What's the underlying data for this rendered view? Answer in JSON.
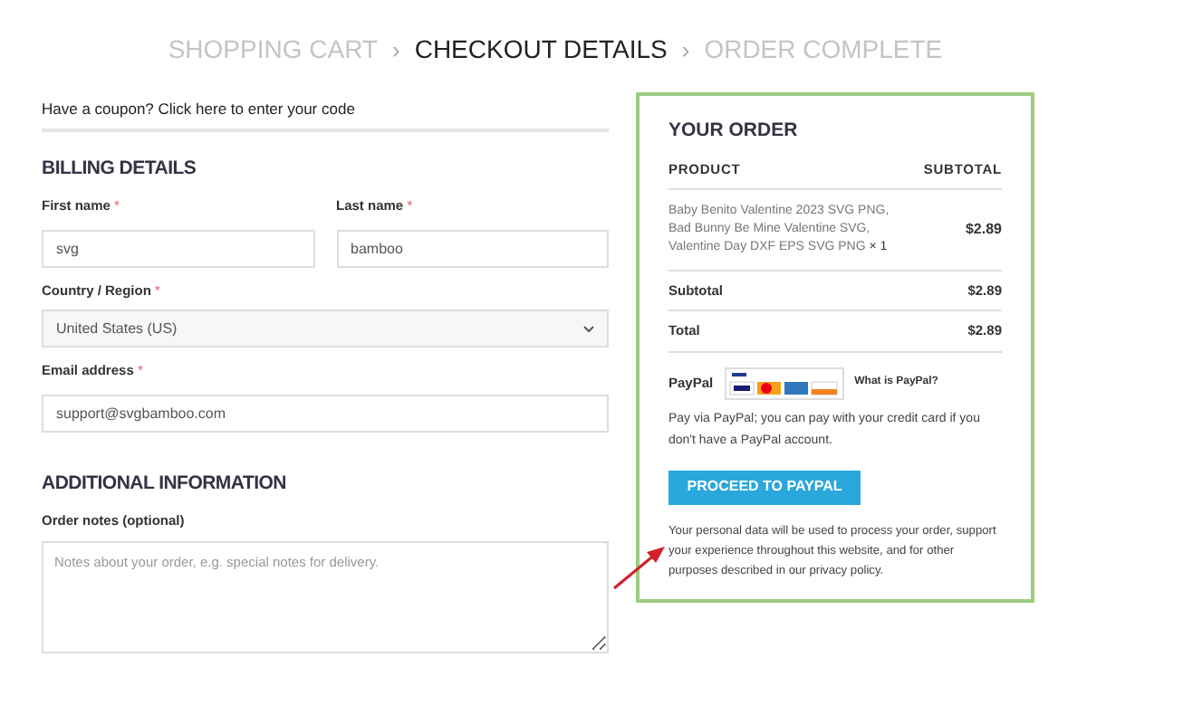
{
  "breadcrumb": [
    {
      "label": "SHOPPING CART",
      "selected": false
    },
    {
      "label": "CHECKOUT DETAILS",
      "selected": true
    },
    {
      "label": "ORDER COMPLETE",
      "selected": false
    }
  ],
  "breadcrumb_separator": "›",
  "coupon_notice": "Have a coupon? Click here to enter your code",
  "billing": {
    "heading": "BILLING DETAILS",
    "fields": [
      {
        "label": "First name",
        "required_mark": "*",
        "value": "svg",
        "kind": "text"
      },
      {
        "label": "Last name",
        "required_mark": "*",
        "value": "bamboo",
        "kind": "text"
      },
      {
        "label": "Country / Region",
        "required_mark": "*",
        "value": "United States (US)",
        "kind": "select"
      },
      {
        "label": "Email address",
        "required_mark": "*",
        "value": "support@svgbamboo.com",
        "kind": "text"
      }
    ]
  },
  "additional": {
    "heading": "ADDITIONAL INFORMATION",
    "label": "Order notes (optional)",
    "placeholder": "Notes about your order, e.g. special notes for delivery."
  },
  "order": {
    "heading": "YOUR ORDER",
    "columns": [
      "PRODUCT",
      "SUBTOTAL"
    ],
    "item": {
      "name": "Baby Benito Valentine 2023 SVG PNG, Bad Bunny Be Mine Valentine SVG, Valentine Day DXF EPS SVG PNG",
      "quantity": "× 1",
      "price": "$2.89"
    },
    "totals": [
      {
        "label": "Subtotal",
        "value": "$2.89"
      },
      {
        "label": "Total",
        "value": "$2.89"
      }
    ],
    "payment": {
      "name": "PayPal",
      "link": "What is PayPal?",
      "description": "Pay via PayPal; you can pay with your credit card if you don't have a PayPal account."
    },
    "button": "PROCEED TO PAYPAL",
    "privacy": "Your personal data will be used to process your order, support your experience throughout this website, and for other purposes described in our privacy policy."
  }
}
